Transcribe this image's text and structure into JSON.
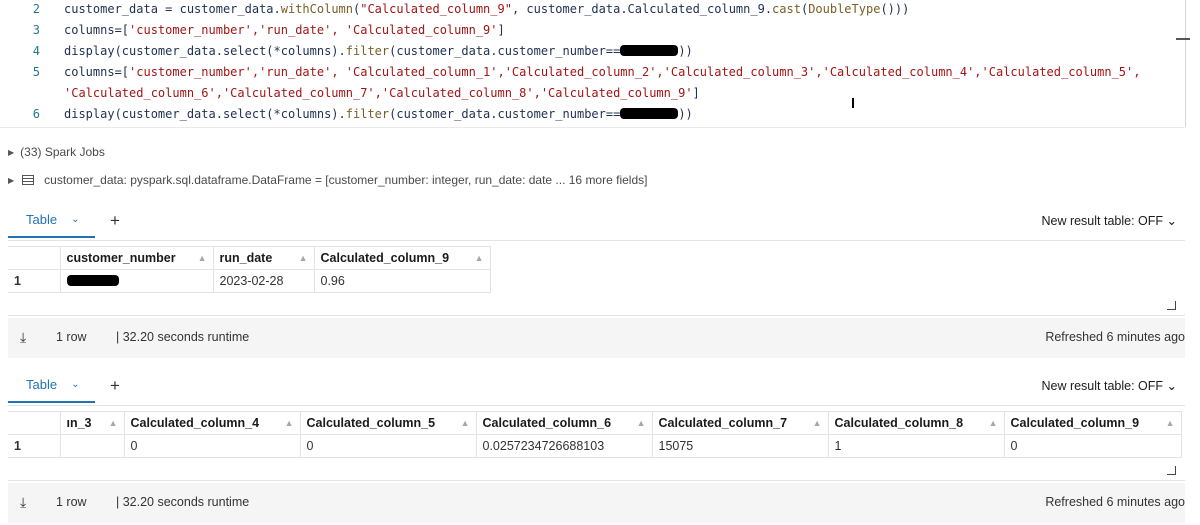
{
  "code": {
    "lines": [
      {
        "num": "2",
        "text_a": "customer_data = customer_data.",
        "fn": "withColumn",
        "text_b": "(",
        "str": "\"Calculated_column_9\"",
        "text_c": ", customer_data.Calculated_column_9.",
        "fn2": "cast",
        "text_d": "(",
        "fn3": "DoubleType",
        "text_e": "()))"
      },
      {
        "num": "3",
        "text_a": "columns=[",
        "str": "'customer_number','run_date', 'Calculated_column_9'",
        "text_b": "]"
      },
      {
        "num": "4",
        "text_a": "display(customer_data.select(*columns).",
        "fn": "filter",
        "text_b": "(customer_data.customer_number==",
        "text_c": "))"
      },
      {
        "num": "5",
        "text_a": "columns=[",
        "str": "'customer_number','run_date', 'Calculated_column_1','Calculated_column_2','Calculated_column_3','Calculated_column_4','Calculated_column_5',"
      },
      {
        "num": "",
        "str": "'Calculated_column_6','Calculated_column_7','Calculated_column_8','Calculated_column_9'",
        "text_b": "]"
      },
      {
        "num": "6",
        "text_a": "display(customer_data.select(*columns).",
        "fn": "filter",
        "text_b": "(customer_data.customer_number==",
        "text_c": "))"
      }
    ]
  },
  "spark_jobs": "(33) Spark Jobs",
  "df_info": "customer_data:  pyspark.sql.dataframe.DataFrame = [customer_number: integer, run_date: date ... 16 more fields]",
  "result1": {
    "tab_label": "Table",
    "new_result_label": "New result table: OFF",
    "columns": [
      "customer_number",
      "run_date",
      "Calculated_column_9"
    ],
    "rows": [
      {
        "num": "1",
        "cells": [
          "",
          "2023-02-28",
          "0.96"
        ]
      }
    ],
    "row_count": "1 row",
    "runtime": "|  32.20 seconds runtime",
    "refreshed": "Refreshed 6 minutes ago"
  },
  "result2": {
    "tab_label": "Table",
    "new_result_label": "New result table: OFF",
    "columns": [
      "ın_3",
      "Calculated_column_4",
      "Calculated_column_5",
      "Calculated_column_6",
      "Calculated_column_7",
      "Calculated_column_8",
      "Calculated_column_9"
    ],
    "rows": [
      {
        "num": "1",
        "cells": [
          "",
          "0",
          "0",
          "0.0257234726688103",
          "15075",
          "1",
          "0"
        ]
      }
    ],
    "row_count": "1 row",
    "runtime": "|  32.20 seconds runtime",
    "refreshed": "Refreshed 6 minutes ago"
  },
  "colors": {
    "accent": "#2272b4",
    "string": "#a31515",
    "function": "#795e26",
    "line_number": "#237893"
  },
  "icons": [
    "triangle-right-icon",
    "table-icon",
    "chevron-down-icon",
    "plus-icon",
    "sort-icon",
    "download-icon",
    "resize-corner-icon"
  ]
}
